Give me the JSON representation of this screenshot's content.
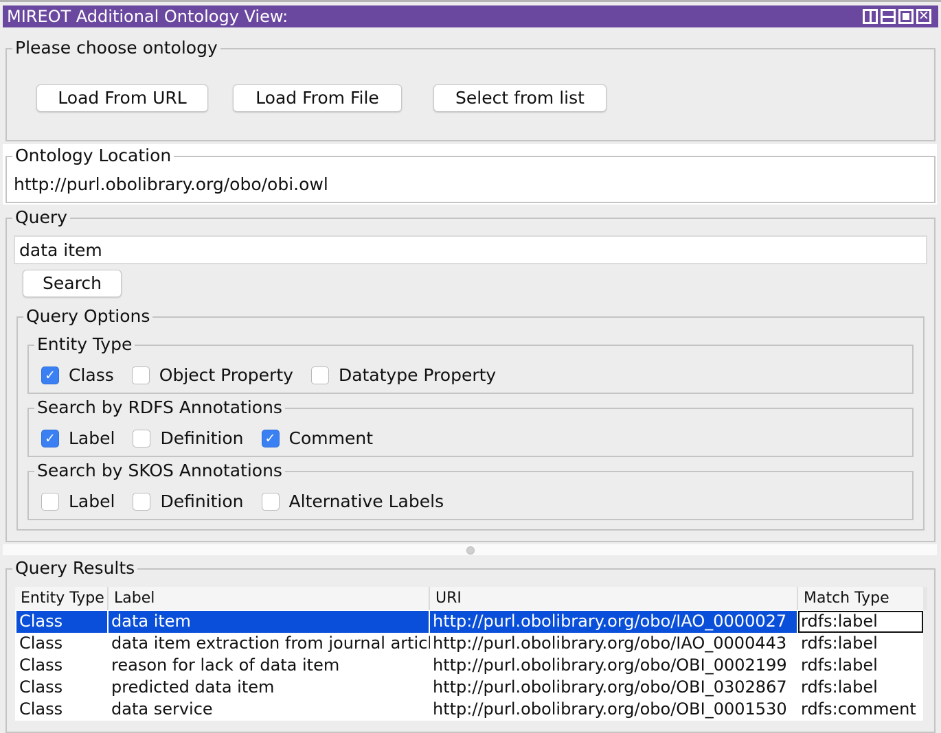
{
  "window": {
    "title": "MIREOT Additional Ontology View:",
    "controls": [
      {
        "name": "split-vertical-icon",
        "kind": "split-v"
      },
      {
        "name": "split-horizontal-icon",
        "kind": "split-h"
      },
      {
        "name": "maximize-icon",
        "kind": "maximize"
      },
      {
        "name": "close-icon",
        "kind": "close",
        "glyph": "✕"
      }
    ]
  },
  "choose": {
    "title": "Please choose ontology",
    "buttons": {
      "load_url": "Load From URL",
      "load_file": "Load From File",
      "select_list": "Select from list"
    }
  },
  "location": {
    "title": "Ontology Location",
    "value": "http://purl.obolibrary.org/obo/obi.owl"
  },
  "query": {
    "title": "Query",
    "input_value": "data item",
    "search_label": "Search",
    "options_title": "Query Options",
    "entity_type": {
      "title": "Entity Type",
      "items": [
        {
          "label": "Class",
          "checked": true
        },
        {
          "label": "Object Property",
          "checked": false
        },
        {
          "label": "Datatype Property",
          "checked": false
        }
      ]
    },
    "rdfs": {
      "title": "Search by RDFS Annotations",
      "items": [
        {
          "label": "Label",
          "checked": true
        },
        {
          "label": "Definition",
          "checked": false
        },
        {
          "label": "Comment",
          "checked": true
        }
      ]
    },
    "skos": {
      "title": "Search by SKOS Annotations",
      "items": [
        {
          "label": "Label",
          "checked": false
        },
        {
          "label": "Definition",
          "checked": false
        },
        {
          "label": "Alternative Labels",
          "checked": false
        }
      ]
    }
  },
  "results": {
    "title": "Query Results",
    "columns": [
      "Entity Type",
      "Label",
      "URI",
      "Match Type"
    ],
    "selected_row": 0,
    "rows": [
      [
        "Class",
        "data item",
        "http://purl.obolibrary.org/obo/IAO_0000027",
        "rdfs:label"
      ],
      [
        "Class",
        "data item extraction from journal article",
        "http://purl.obolibrary.org/obo/IAO_0000443",
        "rdfs:label"
      ],
      [
        "Class",
        "reason for lack of data item",
        "http://purl.obolibrary.org/obo/OBI_0002199",
        "rdfs:label"
      ],
      [
        "Class",
        "predicted data item",
        "http://purl.obolibrary.org/obo/OBI_0302867",
        "rdfs:label"
      ],
      [
        "Class",
        "data service",
        "http://purl.obolibrary.org/obo/OBI_0001530",
        "rdfs:comment"
      ]
    ]
  },
  "colors": {
    "titlebar": "#6b48a0",
    "selection": "#0a4fd9",
    "checkbox_checked": "#3a80f2"
  }
}
